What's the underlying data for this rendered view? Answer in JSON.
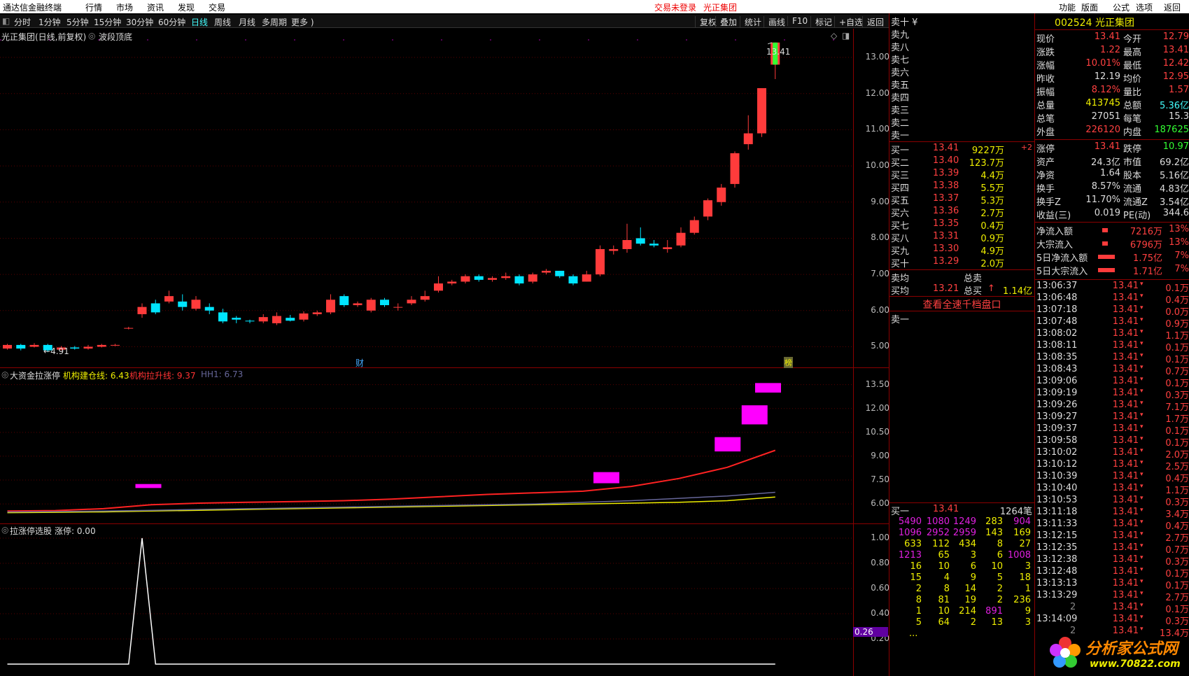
{
  "menubar": {
    "app_title": "通达信金融终端",
    "menu": [
      "行情",
      "市场",
      "资讯",
      "发现",
      "交易"
    ],
    "login_status": "交易未登录",
    "current_stock": "光正集团",
    "right_menu": [
      "功能",
      "版面",
      "公式",
      "选项",
      "返回"
    ]
  },
  "toolbar": {
    "periods": [
      "分时",
      "1分钟",
      "5分钟",
      "15分钟",
      "30分钟",
      "60分钟",
      "日线",
      "周线",
      "月线",
      "多周期",
      "更多 )"
    ],
    "active_period": "日线",
    "actions": [
      "复权",
      "叠加",
      "统计",
      "画线",
      "F10",
      "标记",
      "+自选",
      "返回"
    ]
  },
  "main_chart": {
    "title": "光正集团(日线,前复权)",
    "indicator": "波段顶底",
    "last_price_label": "13.41",
    "low_label": "4.91",
    "marker_cai": "财",
    "marker_bang": "榜",
    "y_ticks": [
      "13.00",
      "12.00",
      "11.00",
      "10.00",
      "9.00",
      "8.00",
      "7.00",
      "6.00",
      "5.00"
    ]
  },
  "indicator1": {
    "title": "大资金拉涨停",
    "line1": "机构建仓线: 6.43",
    "line2": "机构拉升线: 9.37",
    "line3": "HH1: 6.73",
    "y_ticks": [
      "13.50",
      "12.00",
      "10.50",
      "9.00",
      "7.50",
      "6.00"
    ]
  },
  "indicator2": {
    "title": "拉涨停选股",
    "value": "涨停: 0.00",
    "y_ticks": [
      "1.00",
      "0.80",
      "0.60",
      "0.40",
      "0.20"
    ],
    "current_value": "0.26"
  },
  "chart_data": {
    "type": "candlestick",
    "candles": [
      [
        4.95,
        5.05,
        5.08,
        4.92
      ],
      [
        5.05,
        4.95,
        5.08,
        4.9
      ],
      [
        5.0,
        5.05,
        5.1,
        4.98
      ],
      [
        5.05,
        4.9,
        5.08,
        4.85
      ],
      [
        4.92,
        4.98,
        5.02,
        4.9
      ],
      [
        4.98,
        4.95,
        5.02,
        4.92
      ],
      [
        4.95,
        5.0,
        5.05,
        4.92
      ],
      [
        5.0,
        5.05,
        5.08,
        4.98
      ],
      [
        5.05,
        5.05,
        5.08,
        5.02
      ],
      [
        5.5,
        5.52,
        5.55,
        5.48
      ],
      [
        5.9,
        6.1,
        6.2,
        5.8
      ],
      [
        6.2,
        5.95,
        6.3,
        5.9
      ],
      [
        6.25,
        6.4,
        6.55,
        6.2
      ],
      [
        6.25,
        6.1,
        6.45,
        6.0
      ],
      [
        6.05,
        6.3,
        6.4,
        6.0
      ],
      [
        6.1,
        6.0,
        6.2,
        5.9
      ],
      [
        5.95,
        5.7,
        6.05,
        5.65
      ],
      [
        5.8,
        5.75,
        5.85,
        5.65
      ],
      [
        5.72,
        5.7,
        5.75,
        5.65
      ],
      [
        5.7,
        5.82,
        5.9,
        5.65
      ],
      [
        5.65,
        5.85,
        5.95,
        5.6
      ],
      [
        5.8,
        5.72,
        5.88,
        5.7
      ],
      [
        5.75,
        5.92,
        5.98,
        5.7
      ],
      [
        5.9,
        5.95,
        6.0,
        5.85
      ],
      [
        5.95,
        6.3,
        6.45,
        5.9
      ],
      [
        6.4,
        6.15,
        6.45,
        6.1
      ],
      [
        6.15,
        6.2,
        6.25,
        6.1
      ],
      [
        6.0,
        6.3,
        6.35,
        5.95
      ],
      [
        6.3,
        6.15,
        6.35,
        6.1
      ],
      [
        6.1,
        6.1,
        6.2,
        6.0
      ],
      [
        6.2,
        6.3,
        6.4,
        6.15
      ],
      [
        6.3,
        6.4,
        6.55,
        6.25
      ],
      [
        6.55,
        6.75,
        6.95,
        6.5
      ],
      [
        6.75,
        6.8,
        6.85,
        6.7
      ],
      [
        6.8,
        6.95,
        7.0,
        6.75
      ],
      [
        6.95,
        6.85,
        7.0,
        6.8
      ],
      [
        6.85,
        6.9,
        6.95,
        6.8
      ],
      [
        6.9,
        6.95,
        7.05,
        6.85
      ],
      [
        6.95,
        6.75,
        7.0,
        6.7
      ],
      [
        6.8,
        7.0,
        7.05,
        6.75
      ],
      [
        7.05,
        7.1,
        7.15,
        7.0
      ],
      [
        7.1,
        6.95,
        7.1,
        6.9
      ],
      [
        6.95,
        6.75,
        7.0,
        6.7
      ],
      [
        6.8,
        7.0,
        7.1,
        6.8
      ],
      [
        7.0,
        7.7,
        7.8,
        6.95
      ],
      [
        7.65,
        7.7,
        7.8,
        7.55
      ],
      [
        7.7,
        7.95,
        8.4,
        7.6
      ],
      [
        8.0,
        7.85,
        8.3,
        7.8
      ],
      [
        7.85,
        7.8,
        7.95,
        7.75
      ],
      [
        7.7,
        7.75,
        7.95,
        7.6
      ],
      [
        7.8,
        8.15,
        8.3,
        7.75
      ],
      [
        8.15,
        8.5,
        8.6,
        8.1
      ],
      [
        8.6,
        9.05,
        9.1,
        8.5
      ],
      [
        9.0,
        9.4,
        9.5,
        8.9
      ],
      [
        9.5,
        10.35,
        10.4,
        9.4
      ],
      [
        10.6,
        10.9,
        11.4,
        10.45
      ],
      [
        10.9,
        12.15,
        12.15,
        10.8
      ],
      [
        12.8,
        13.41,
        13.41,
        12.4
      ]
    ],
    "ylim": [
      4.7,
      13.6
    ],
    "series": [
      {
        "name": "机构建仓线",
        "values": [
          5.45,
          5.47,
          5.5,
          5.55,
          5.6,
          5.65,
          5.7,
          5.75,
          5.8,
          5.85,
          5.9,
          5.95,
          6.0,
          6.05,
          6.1,
          6.2,
          6.43
        ]
      },
      {
        "name": "机构拉升线",
        "values": [
          5.55,
          5.58,
          5.7,
          5.95,
          6.05,
          6.1,
          6.15,
          6.2,
          6.3,
          6.45,
          6.6,
          6.7,
          6.8,
          7.1,
          7.6,
          8.3,
          9.37
        ]
      },
      {
        "name": "HH1",
        "values": [
          5.5,
          5.52,
          5.55,
          5.6,
          5.65,
          5.7,
          5.75,
          5.8,
          5.85,
          5.9,
          5.95,
          6.0,
          6.1,
          6.2,
          6.35,
          6.5,
          6.73
        ]
      }
    ],
    "zt_signal": [
      0,
      0,
      0,
      0,
      0,
      0,
      0,
      0,
      0,
      0,
      1,
      0,
      0,
      0,
      0,
      0,
      0,
      0,
      0,
      0,
      0,
      0,
      0,
      0,
      0,
      0,
      0,
      0,
      0,
      0,
      0,
      0,
      0,
      0,
      0,
      0,
      0,
      0,
      0,
      0,
      0,
      0,
      0,
      0,
      0,
      0,
      0,
      0,
      0,
      0,
      0,
      0,
      0,
      0,
      0,
      0,
      0,
      0
    ]
  },
  "quote": {
    "code_name": "002524 光正集团",
    "sell_labels": [
      "卖十 ¥",
      "卖九",
      "卖八",
      "卖七",
      "卖六",
      "卖五",
      "卖四",
      "卖三",
      "卖二",
      "卖一"
    ],
    "buy": [
      [
        "买一",
        "13.41",
        "9227万",
        "+2"
      ],
      [
        "买二",
        "13.40",
        "123.7万",
        ""
      ],
      [
        "买三",
        "13.39",
        "4.4万",
        ""
      ],
      [
        "买四",
        "13.38",
        "5.5万",
        ""
      ],
      [
        "买五",
        "13.37",
        "5.3万",
        ""
      ],
      [
        "买六",
        "13.36",
        "2.7万",
        ""
      ],
      [
        "买七",
        "13.35",
        "0.4万",
        ""
      ],
      [
        "买八",
        "13.31",
        "0.9万",
        ""
      ],
      [
        "买九",
        "13.30",
        "4.9万",
        ""
      ],
      [
        "买十",
        "13.29",
        "2.0万",
        ""
      ]
    ],
    "sell_avg_label": "卖均",
    "total_sell_label": "总卖",
    "buy_avg_label": "买均",
    "buy_avg": "13.21",
    "total_buy_label": "总买",
    "total_buy": "1.14亿",
    "full_book_link": "查看全速千档盘口",
    "sell1_queue_label": "卖一",
    "buy1_queue_header": [
      "买一",
      "13.41",
      "1264笔"
    ],
    "queue": [
      [
        "5490",
        "1080",
        "1249",
        "283",
        "904"
      ],
      [
        "1096",
        "2952",
        "2959",
        "143",
        "169"
      ],
      [
        "633",
        "112",
        "434",
        "8",
        "27"
      ],
      [
        "1213",
        "65",
        "3",
        "6",
        "1008"
      ],
      [
        "16",
        "10",
        "6",
        "10",
        "3"
      ],
      [
        "15",
        "4",
        "9",
        "5",
        "18"
      ],
      [
        "2",
        "8",
        "14",
        "2",
        "1"
      ],
      [
        "8",
        "81",
        "19",
        "2",
        "236"
      ],
      [
        "1",
        "10",
        "214",
        "891",
        "9"
      ],
      [
        "5",
        "64",
        "2",
        "13",
        "3"
      ]
    ],
    "queue_more": "...",
    "stats": [
      [
        "现价",
        "13.41",
        "今开",
        "12.79"
      ],
      [
        "涨跌",
        "1.22",
        "最高",
        "13.41"
      ],
      [
        "涨幅",
        "10.01%",
        "最低",
        "12.42"
      ],
      [
        "昨收",
        "12.19",
        "均价",
        "12.95"
      ],
      [
        "振幅",
        "8.12%",
        "量比",
        "1.57"
      ],
      [
        "总量",
        "413745",
        "总额",
        "5.36亿"
      ],
      [
        "总笔",
        "27051",
        "每笔",
        "15.3"
      ],
      [
        "外盘",
        "226120",
        "内盘",
        "187625"
      ]
    ],
    "finance": [
      [
        "涨停",
        "13.41",
        "跌停",
        "10.97"
      ],
      [
        "资产",
        "24.3亿",
        "市值",
        "69.2亿"
      ],
      [
        "净资",
        "1.64",
        "股本",
        "5.16亿"
      ],
      [
        "换手",
        "8.57%",
        "流通",
        "4.83亿"
      ],
      [
        "换手Z",
        "11.70%",
        "流通Z",
        "3.54亿"
      ],
      [
        "收益(三)",
        "0.019",
        "PE(动)",
        "344.6"
      ]
    ],
    "flows": [
      [
        "净流入额",
        "7216万",
        "13%"
      ],
      [
        "大宗流入",
        "6796万",
        "13%"
      ],
      [
        "5日净流入额",
        "1.75亿",
        "7%"
      ],
      [
        "5日大宗流入",
        "1.71亿",
        "7%"
      ]
    ],
    "ticks": [
      [
        "13:06:37",
        "13.41",
        "0.1万"
      ],
      [
        "13:06:48",
        "13.41",
        "0.4万"
      ],
      [
        "13:07:18",
        "13.41",
        "0.0万"
      ],
      [
        "13:07:48",
        "13.41",
        "0.9万"
      ],
      [
        "13:08:02",
        "13.41",
        "1.1万"
      ],
      [
        "13:08:11",
        "13.41",
        "0.1万"
      ],
      [
        "13:08:35",
        "13.41",
        "0.1万"
      ],
      [
        "13:08:43",
        "13.41",
        "0.7万"
      ],
      [
        "13:09:06",
        "13.41",
        "0.1万"
      ],
      [
        "13:09:19",
        "13.41",
        "0.3万"
      ],
      [
        "13:09:26",
        "13.41",
        "7.1万"
      ],
      [
        "13:09:27",
        "13.41",
        "1.7万"
      ],
      [
        "13:09:37",
        "13.41",
        "0.1万"
      ],
      [
        "13:09:58",
        "13.41",
        "0.1万"
      ],
      [
        "13:10:02",
        "13.41",
        "2.0万"
      ],
      [
        "13:10:12",
        "13.41",
        "2.5万"
      ],
      [
        "13:10:39",
        "13.41",
        "0.4万"
      ],
      [
        "13:10:40",
        "13.41",
        "1.1万"
      ],
      [
        "13:10:53",
        "13.41",
        "0.3万"
      ],
      [
        "13:11:18",
        "13.41",
        "3.4万"
      ],
      [
        "13:11:33",
        "13.41",
        "0.4万"
      ],
      [
        "13:12:15",
        "13.41",
        "2.7万"
      ],
      [
        "13:12:35",
        "13.41",
        "0.7万"
      ],
      [
        "13:12:38",
        "13.41",
        "0.3万"
      ],
      [
        "13:12:48",
        "13.41",
        "0.1万"
      ],
      [
        "13:13:13",
        "13.41",
        "0.1万"
      ],
      [
        "13:13:29",
        "13.41",
        "2.7万"
      ],
      [
        "2",
        "13.41",
        "0.1万"
      ],
      [
        "13:14:09",
        "13.41",
        "0.3万"
      ],
      [
        "2",
        "13.41",
        "13.4万"
      ]
    ],
    "watermark_name": "分析家公式网",
    "watermark_url": "www.70822.com"
  }
}
